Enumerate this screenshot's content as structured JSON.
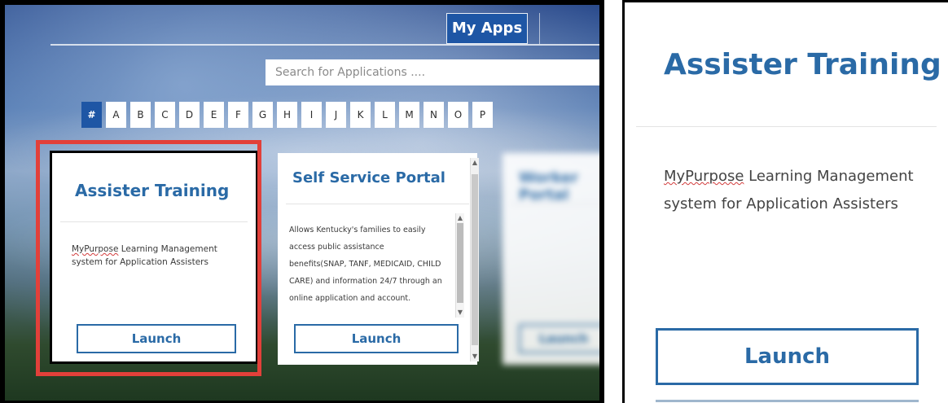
{
  "header": {
    "my_apps_label": "My Apps"
  },
  "search": {
    "placeholder": "Search for Applications ...."
  },
  "alphabet": {
    "items": [
      "#",
      "A",
      "B",
      "C",
      "D",
      "E",
      "F",
      "G",
      "H",
      "I",
      "J",
      "K",
      "L",
      "M",
      "N",
      "O",
      "P"
    ],
    "active_index": 0
  },
  "cards": [
    {
      "title": "Assister Training",
      "desc_prefix": "MyPurpose",
      "desc_rest": " Learning Management system for Application Assisters",
      "launch_label": "Launch"
    },
    {
      "title": "Self Service Portal",
      "description": "Allows Kentucky's families to easily access public assistance benefits(SNAP, TANF, MEDICAID, CHILD CARE) and information 24/7 through an online application and account.",
      "launch_label": "Launch"
    },
    {
      "title": "Worker Portal",
      "launch_label": "Launch"
    }
  ],
  "zoom": {
    "title": "Assister Training",
    "desc_prefix": "MyPurpose",
    "desc_rest": " Learning Management system for Application Assisters",
    "launch_label": "Launch"
  },
  "colors": {
    "accent_blue": "#2a6aa6",
    "tab_blue": "#1e56a5",
    "highlight_red": "#e2403a"
  }
}
